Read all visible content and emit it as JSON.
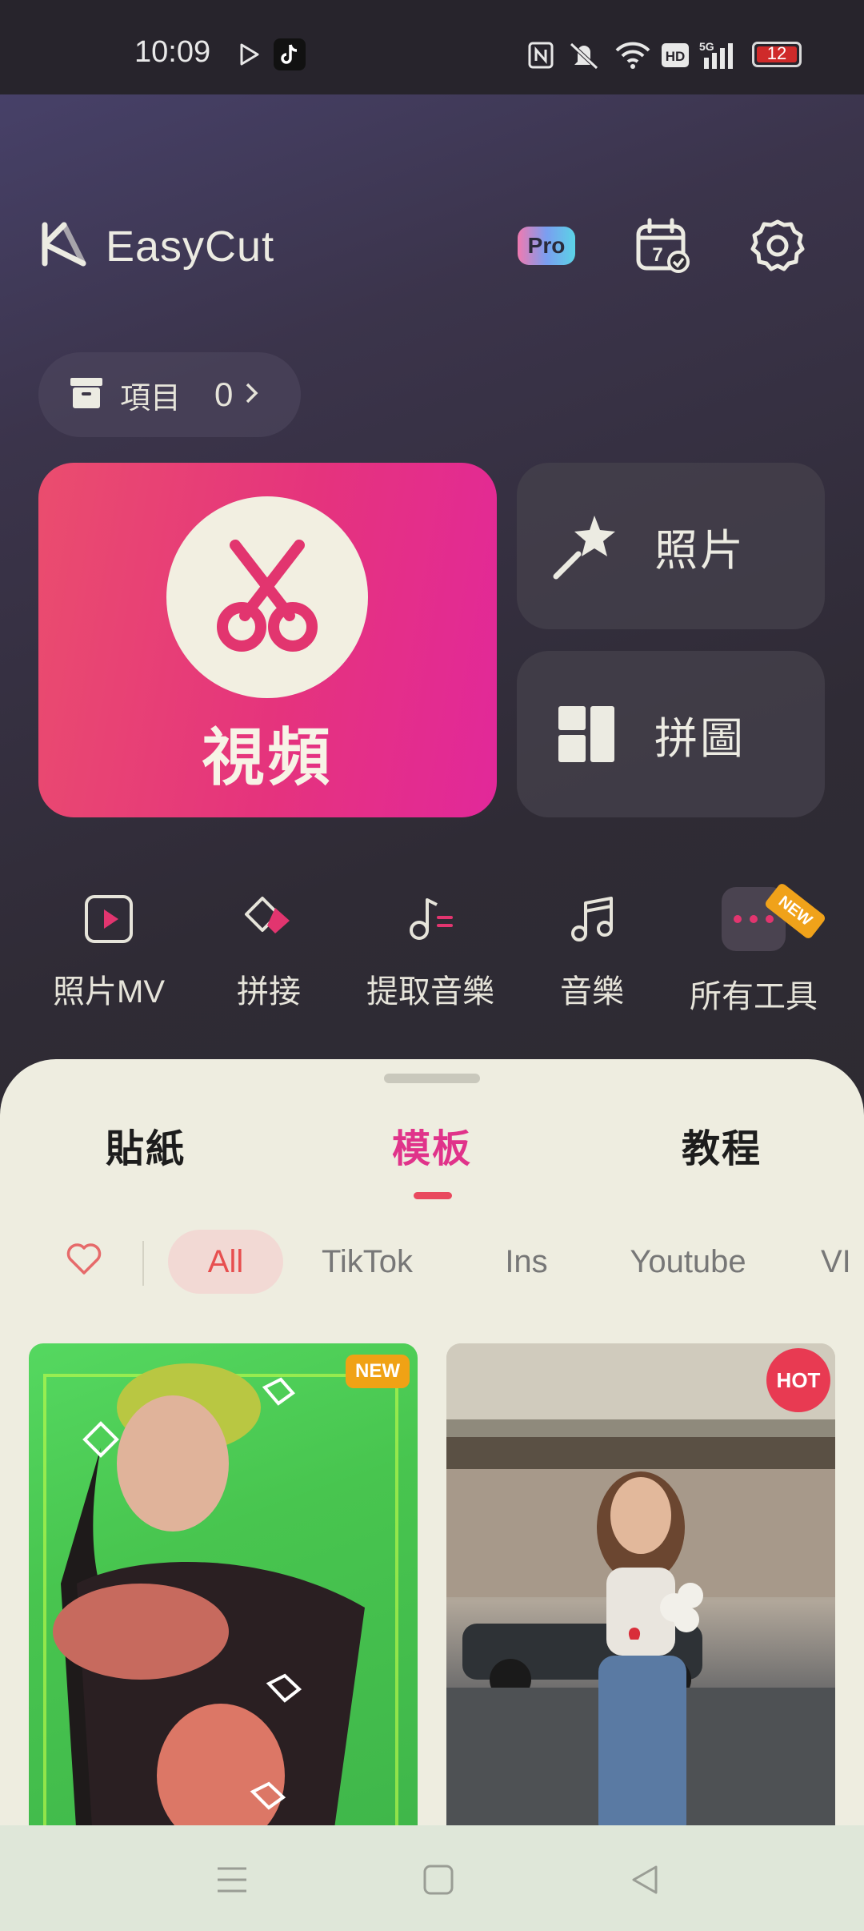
{
  "status_bar": {
    "time": "10:09",
    "battery": "12",
    "icons": [
      "play-store-icon",
      "tiktok-icon",
      "nfc-icon",
      "mute-icon",
      "wifi-icon",
      "hd-icon",
      "signal-5g-icon",
      "battery-icon"
    ]
  },
  "header": {
    "app_name": "EasyCut",
    "pro_label": "Pro",
    "calendar_day": "7"
  },
  "projects": {
    "label": "項目",
    "count": "0"
  },
  "main_actions": {
    "video_label": "視頻",
    "photo_label": "照片",
    "collage_label": "拼圖"
  },
  "tools": [
    {
      "label": "照片MV",
      "icon": "play-square-icon"
    },
    {
      "label": "拼接",
      "icon": "merge-icon"
    },
    {
      "label": "提取音樂",
      "icon": "extract-music-icon"
    },
    {
      "label": "音樂",
      "icon": "music-note-icon"
    },
    {
      "label": "所有工具",
      "icon": "more-dots-icon",
      "badge": "NEW"
    }
  ],
  "sheet": {
    "tabs": [
      "貼紙",
      "模板",
      "教程"
    ],
    "active_tab": "模板",
    "chips": [
      "All",
      "TikTok",
      "Ins",
      "Youtube",
      "VI"
    ],
    "active_chip": "All",
    "cards": [
      {
        "badge": "NEW",
        "badge_color": "#f0a215"
      },
      {
        "badge": "HOT",
        "badge_color": "#e83a52"
      }
    ]
  },
  "colors": {
    "accent_pink": "#e0338a",
    "video_gradient_start": "#ea4d6e",
    "video_gradient_end": "#e2289a",
    "sheet_bg": "#eeede0"
  }
}
